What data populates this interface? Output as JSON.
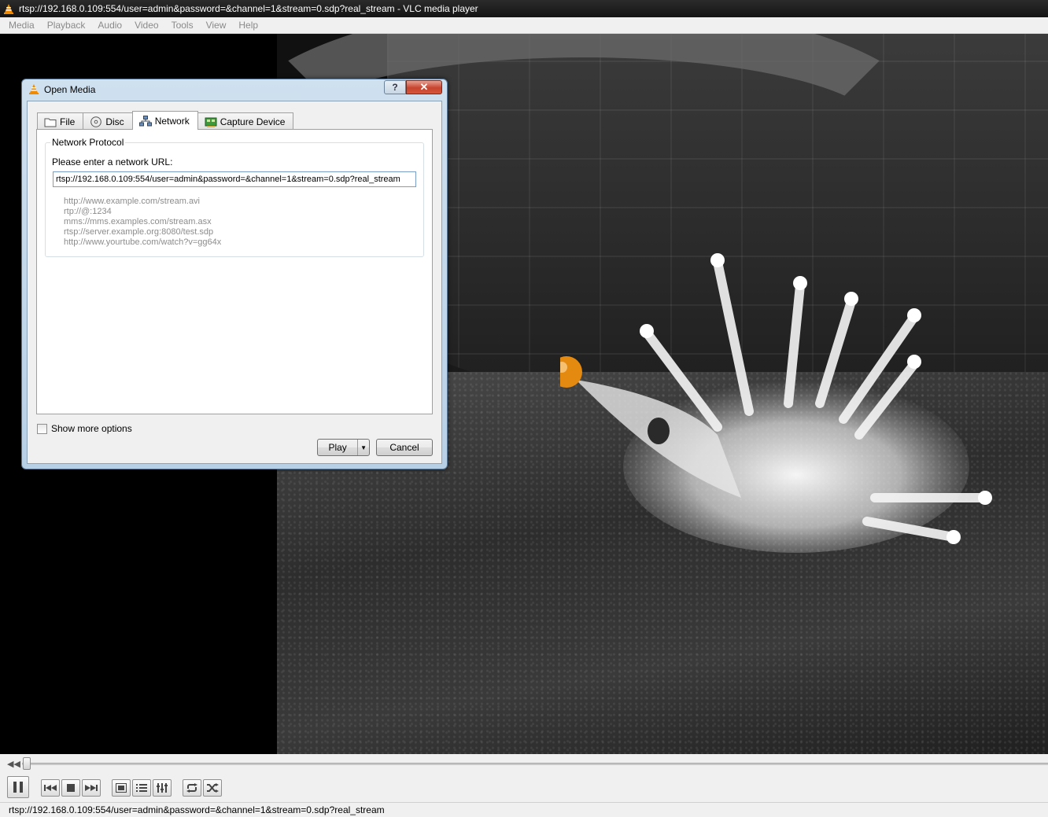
{
  "window": {
    "title": "rtsp://192.168.0.109:554/user=admin&password=&channel=1&stream=0.sdp?real_stream - VLC media player"
  },
  "menu": [
    "Media",
    "Playback",
    "Audio",
    "Video",
    "Tools",
    "View",
    "Help"
  ],
  "dialog": {
    "title": "Open Media",
    "help_label": "?",
    "close_label": "✕",
    "tabs": [
      {
        "label": "File",
        "icon": "folder-icon",
        "active": false
      },
      {
        "label": "Disc",
        "icon": "disc-icon",
        "active": false
      },
      {
        "label": "Network",
        "icon": "network-icon",
        "active": true
      },
      {
        "label": "Capture Device",
        "icon": "capture-card-icon",
        "active": false
      }
    ],
    "group_label": "Network Protocol",
    "url_prompt": "Please enter a network URL:",
    "url_value": "rtsp://192.168.0.109:554/user=admin&password=&channel=1&stream=0.sdp?real_stream",
    "examples": [
      "http://www.example.com/stream.avi",
      "rtp://@:1234",
      "mms://mms.examples.com/stream.asx",
      "rtsp://server.example.org:8080/test.sdp",
      "http://www.yourtube.com/watch?v=gg64x"
    ],
    "show_more_options": "Show more options",
    "play_label": "Play",
    "cancel_label": "Cancel"
  },
  "status": {
    "text": "rtsp://192.168.0.109:554/user=admin&password=&channel=1&stream=0.sdp?real_stream"
  },
  "colors": {
    "title_bg": "#1c1c1c",
    "dialog_frame": "#b8d0e6",
    "close_red": "#c7442e",
    "vlc_orange": "#f08a00"
  }
}
